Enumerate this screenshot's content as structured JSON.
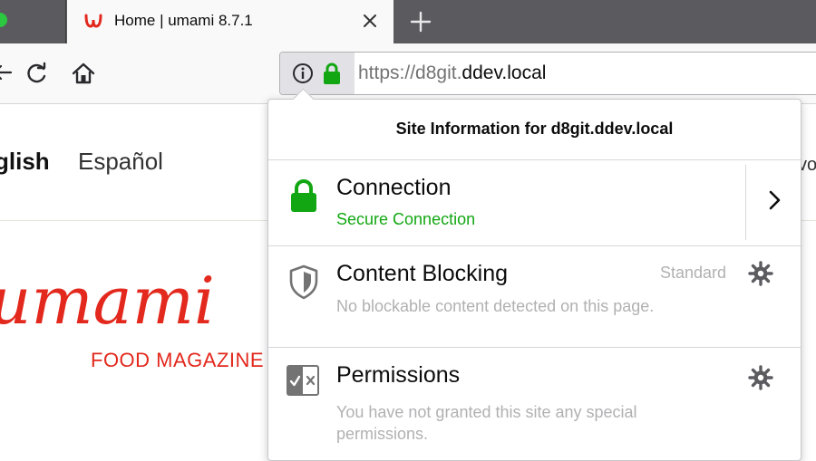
{
  "tab": {
    "title": "Home | umami 8.7.1"
  },
  "urlbar": {
    "scheme": "https://",
    "subdomain": "d8git.",
    "host": "ddev.local"
  },
  "page": {
    "languages": [
      "glish",
      "Español"
    ],
    "language_right_fragment": "vo",
    "logo_text": "umami",
    "tagline": "FOOD MAGAZINE"
  },
  "popup": {
    "title": "Site Information for d8git.ddev.local",
    "connection": {
      "heading": "Connection",
      "status": "Secure Connection"
    },
    "content_blocking": {
      "heading": "Content Blocking",
      "level": "Standard",
      "status": "No blockable content detected on this page."
    },
    "permissions": {
      "heading": "Permissions",
      "line1": "You have not granted this site any special",
      "line2": "permissions."
    }
  },
  "colors": {
    "secure_green": "#12a712",
    "brand_red": "#e3281d",
    "tab_strip": "#5b5b5f"
  }
}
